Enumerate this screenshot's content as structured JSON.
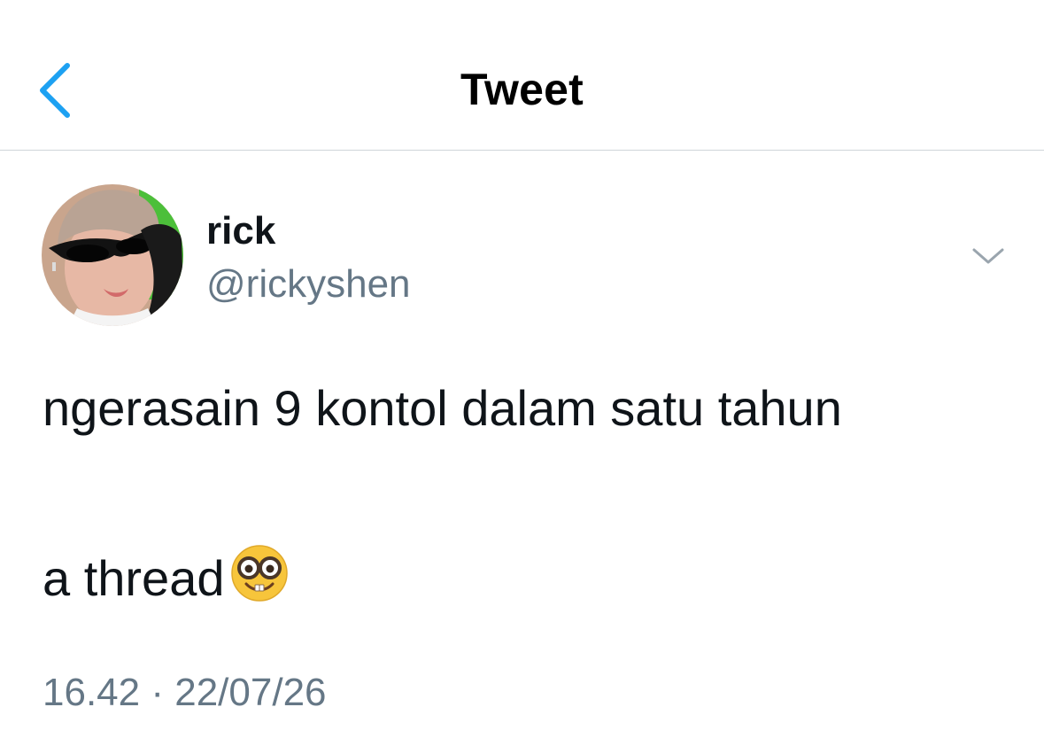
{
  "header": {
    "title": "Tweet",
    "back_icon": "chevron-left-icon",
    "accent_color": "#1da1f2"
  },
  "author": {
    "display_name": "rick",
    "handle": "@rickyshen",
    "avatar_icon": "profile-photo",
    "more_icon": "chevron-down-icon"
  },
  "tweet": {
    "line1": "ngerasain 9 kontol dalam satu tahun",
    "line2": "a thread",
    "emoji": "nerd-face-emoji"
  },
  "meta": {
    "time": "16.42",
    "separator": "·",
    "date": "22/07/26"
  },
  "colors": {
    "text": "#0f1419",
    "secondary": "#657786",
    "divider": "#cfd5da"
  }
}
